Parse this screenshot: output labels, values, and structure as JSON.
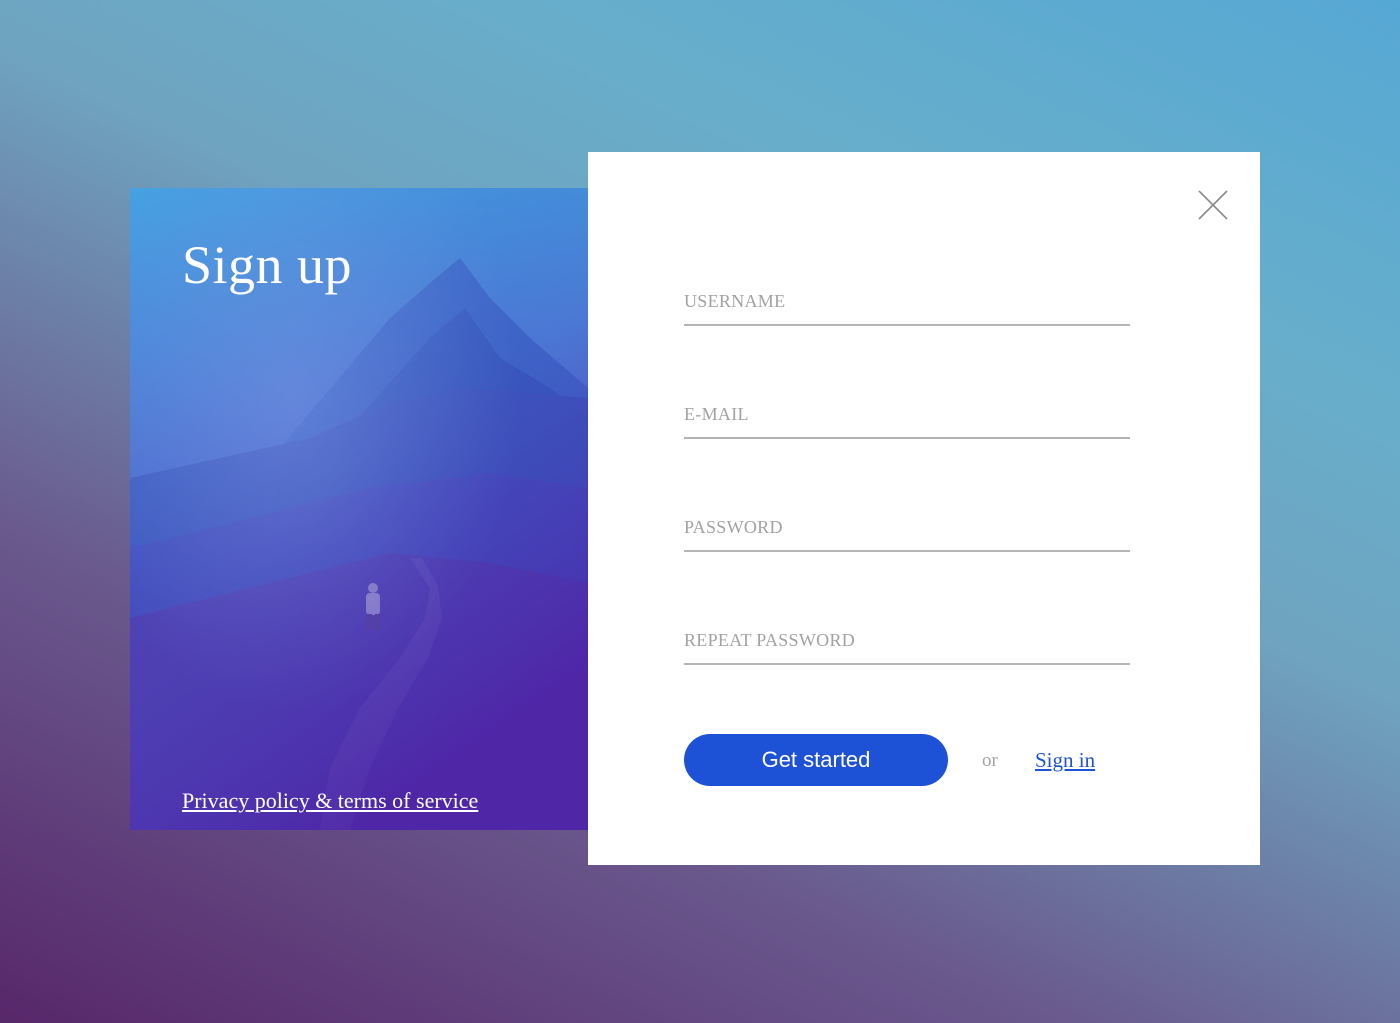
{
  "signup": {
    "title": "Sign up",
    "privacy_link": "Privacy policy & terms of service"
  },
  "form": {
    "fields": [
      {
        "placeholder": "USERNAME",
        "value": ""
      },
      {
        "placeholder": "E-MAIL",
        "value": ""
      },
      {
        "placeholder": "PASSWORD",
        "value": ""
      },
      {
        "placeholder": "REPEAT PASSWORD",
        "value": ""
      }
    ],
    "submit_label": "Get started",
    "or_label": "or",
    "signin_label": "Sign in"
  },
  "icons": {
    "close": "close-icon"
  },
  "colors": {
    "accent": "#1e52d6",
    "panel_gradient_top": "#3aa0e0",
    "panel_gradient_bottom": "#4a22a8",
    "input_underline": "#b4b4b4",
    "placeholder": "#a2a2a2"
  }
}
